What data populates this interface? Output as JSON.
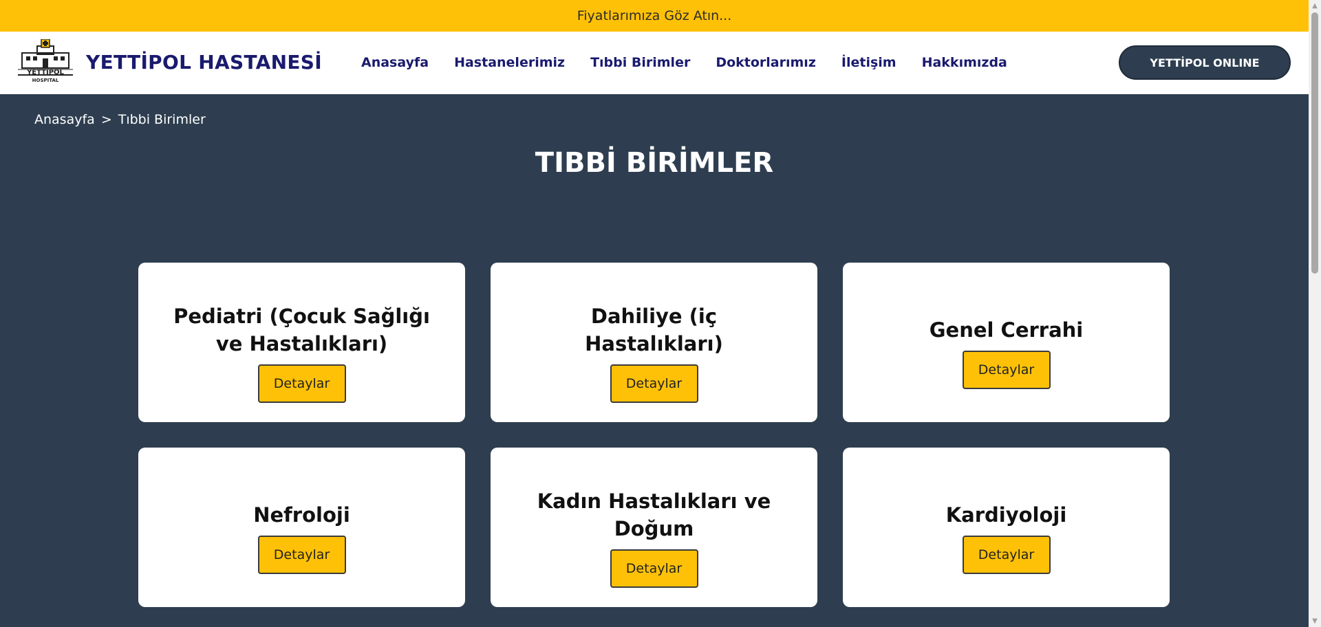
{
  "promo": {
    "text": "Fiyatlarımıza Göz Atın..."
  },
  "header": {
    "brand": "YETTİPOL HASTANESİ",
    "logo": {
      "name": "YETTİPOL",
      "subtitle": "HOSPITAL"
    },
    "nav": [
      {
        "label": "Anasayfa"
      },
      {
        "label": "Hastanelerimiz"
      },
      {
        "label": "Tıbbi Birimler"
      },
      {
        "label": "Doktorlarımız"
      },
      {
        "label": "İletişim"
      },
      {
        "label": "Hakkımızda"
      }
    ],
    "cta_label": "YETTİPOL ONLINE"
  },
  "breadcrumb": {
    "home": "Anasayfa",
    "separator": ">",
    "current": "Tıbbi Birimler"
  },
  "page_title": "TIBBİ BİRİMLER",
  "cards": [
    {
      "title": "Pediatri (Çocuk Sağlığı ve Hastalıkları)",
      "button": "Detaylar"
    },
    {
      "title": "Dahiliye (iç Hastalıkları)",
      "button": "Detaylar"
    },
    {
      "title": "Genel Cerrahi",
      "button": "Detaylar"
    },
    {
      "title": "Nefroloji",
      "button": "Detaylar"
    },
    {
      "title": "Kadın Hastalıkları ve Doğum",
      "button": "Detaylar"
    },
    {
      "title": "Kardiyoloji",
      "button": "Detaylar"
    }
  ],
  "colors": {
    "accent": "#ffc107",
    "background": "#2e3e50",
    "brand_text": "#1a1a6e"
  },
  "icons": {
    "logo": "hospital-building-icon"
  }
}
